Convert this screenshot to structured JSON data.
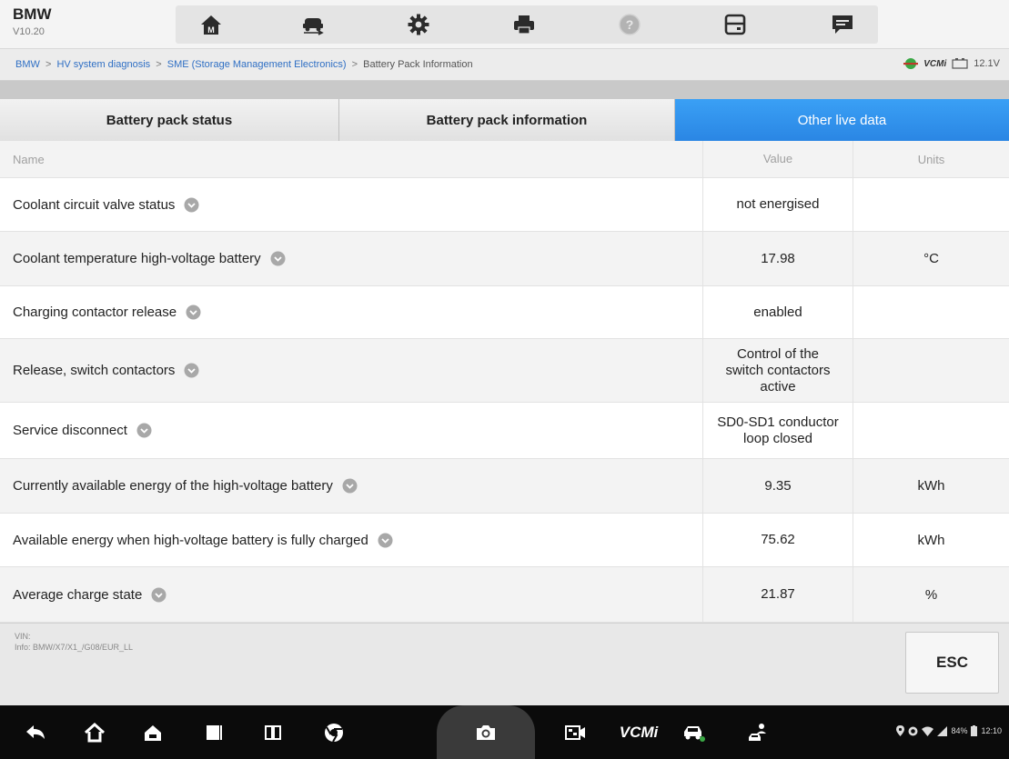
{
  "app": {
    "brand": "BMW",
    "version": "V10.20"
  },
  "toolbar": {
    "buttons": [
      {
        "icon": "home-icon"
      },
      {
        "icon": "vehicle-swap-icon"
      },
      {
        "icon": "gear-icon"
      },
      {
        "icon": "print-icon"
      },
      {
        "icon": "help-icon"
      },
      {
        "icon": "save-icon"
      },
      {
        "icon": "message-icon"
      }
    ]
  },
  "breadcrumb": {
    "items": [
      "BMW",
      "HV system diagnosis",
      "SME (Storage Management Electronics)"
    ],
    "current": "Battery Pack Information",
    "separator": ">"
  },
  "status": {
    "vci_label": "VCMi",
    "battery_voltage": "12.1V"
  },
  "tabs": [
    {
      "label": "Battery pack status",
      "active": false
    },
    {
      "label": "Battery pack information",
      "active": false
    },
    {
      "label": "Other live data",
      "active": true
    }
  ],
  "table": {
    "headers": {
      "name": "Name",
      "value": "Value",
      "units": "Units"
    },
    "rows": [
      {
        "name": "Coolant circuit valve status",
        "value": "not energised",
        "units": ""
      },
      {
        "name": "Coolant temperature high-voltage battery",
        "value": "17.98",
        "units": "°C"
      },
      {
        "name": "Charging contactor release",
        "value": "enabled",
        "units": ""
      },
      {
        "name": "Release, switch contactors",
        "value_lines": [
          "Control of the",
          "switch contactors",
          "active"
        ],
        "units": ""
      },
      {
        "name": "Service disconnect",
        "value_lines": [
          "SD0-SD1 conductor",
          "loop closed"
        ],
        "units": ""
      },
      {
        "name": "Currently available energy of the high-voltage battery",
        "value": "9.35",
        "units": "kWh"
      },
      {
        "name": "Available energy when high-voltage battery is fully charged",
        "value": "75.62",
        "units": "kWh"
      },
      {
        "name": "Average charge state",
        "value": "21.87",
        "units": "%"
      }
    ]
  },
  "footer": {
    "vin_label": "VIN:",
    "info": "Info: BMW/X7/X1_/G08/EUR_LL",
    "esc_label": "ESC"
  },
  "navbar": {
    "vcmi_label": "VCMi",
    "battery_percent": "84%",
    "time": "12:10"
  },
  "colors": {
    "accent": "#2a86e4",
    "link": "#2f6fc4",
    "dropdown_icon": "#a8a8a8"
  }
}
